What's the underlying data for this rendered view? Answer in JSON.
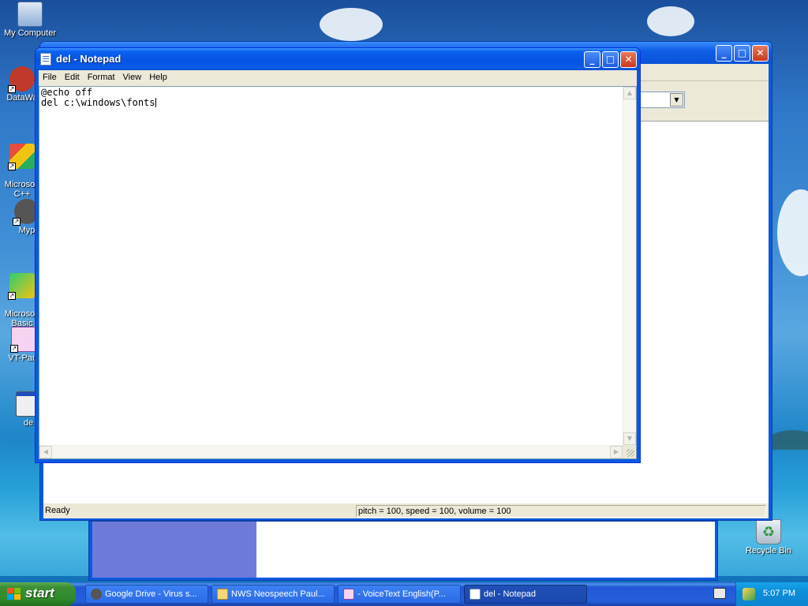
{
  "desktop": {
    "icons": [
      {
        "label": "My Computer"
      },
      {
        "label": "DataWa"
      },
      {
        "label": "Microsoft\nC++"
      },
      {
        "label": "Myp"
      },
      {
        "label": "Microsoft\nBasic"
      },
      {
        "label": "VT-Paul"
      },
      {
        "label": "de"
      },
      {
        "label": "Recycle Bin"
      }
    ]
  },
  "voicetext_window": {
    "status_ready": "Ready",
    "status_params": "pitch = 100, speed = 100, volume = 100"
  },
  "notepad": {
    "title": "del - Notepad",
    "menu": [
      "File",
      "Edit",
      "Format",
      "View",
      "Help"
    ],
    "content_lines": [
      "@echo off",
      "del c:\\windows\\fonts"
    ]
  },
  "taskbar": {
    "start_label": "start",
    "tasks": [
      {
        "label": "Google Drive - Virus s...",
        "icon": "firefox-like-icon"
      },
      {
        "label": "NWS Neospeech Paul...",
        "icon": "folder-icon"
      },
      {
        "label": "- VoiceText English(P...",
        "icon": "voicetext-app-icon"
      },
      {
        "label": "del - Notepad",
        "icon": "notepad-icon"
      }
    ],
    "clock": "5:07 PM"
  }
}
